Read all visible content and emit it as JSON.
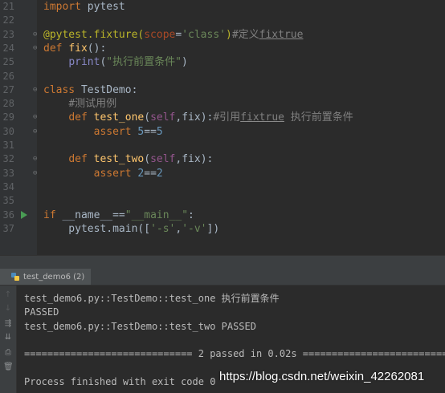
{
  "editor": {
    "line_numbers": [
      "21",
      "22",
      "23",
      "24",
      "25",
      "26",
      "27",
      "28",
      "29",
      "30",
      "31",
      "32",
      "33",
      "34",
      "35",
      "36",
      "37"
    ],
    "lines": [
      [
        {
          "t": "import",
          "c": "kw"
        },
        {
          "t": " pytest",
          "c": ""
        }
      ],
      [],
      [
        {
          "t": "@pytest.fixture(",
          "c": "dec"
        },
        {
          "t": "scope",
          "c": "param"
        },
        {
          "t": "=",
          "c": ""
        },
        {
          "t": "'class'",
          "c": "str"
        },
        {
          "t": ")",
          "c": "dec"
        },
        {
          "t": "#定义",
          "c": "cmt"
        },
        {
          "t": "fixtrue",
          "c": "cmt link"
        }
      ],
      [
        {
          "t": "def ",
          "c": "kw"
        },
        {
          "t": "fix",
          "c": "fn"
        },
        {
          "t": "():",
          "c": ""
        }
      ],
      [
        {
          "t": "    ",
          "c": ""
        },
        {
          "t": "print",
          "c": "bi"
        },
        {
          "t": "(",
          "c": ""
        },
        {
          "t": "\"执行前置条件\"",
          "c": "str"
        },
        {
          "t": ")",
          "c": ""
        }
      ],
      [],
      [
        {
          "t": "class ",
          "c": "kw"
        },
        {
          "t": "TestDemo:",
          "c": ""
        }
      ],
      [
        {
          "t": "    ",
          "c": ""
        },
        {
          "t": "#测试用例",
          "c": "cmt"
        }
      ],
      [
        {
          "t": "    ",
          "c": ""
        },
        {
          "t": "def ",
          "c": "kw"
        },
        {
          "t": "test_one",
          "c": "fn"
        },
        {
          "t": "(",
          "c": ""
        },
        {
          "t": "self",
          "c": "self"
        },
        {
          "t": ",fix):",
          "c": ""
        },
        {
          "t": "#引用",
          "c": "cmt"
        },
        {
          "t": "fixtrue",
          "c": "cmt link"
        },
        {
          "t": " 执行前置条件",
          "c": "cmt"
        }
      ],
      [
        {
          "t": "        ",
          "c": ""
        },
        {
          "t": "assert ",
          "c": "kw"
        },
        {
          "t": "5",
          "c": "num"
        },
        {
          "t": "==",
          "c": ""
        },
        {
          "t": "5",
          "c": "num"
        }
      ],
      [],
      [
        {
          "t": "    ",
          "c": ""
        },
        {
          "t": "def ",
          "c": "kw"
        },
        {
          "t": "test_two",
          "c": "fn"
        },
        {
          "t": "(",
          "c": ""
        },
        {
          "t": "self",
          "c": "self"
        },
        {
          "t": ",fix):",
          "c": ""
        }
      ],
      [
        {
          "t": "        ",
          "c": ""
        },
        {
          "t": "assert ",
          "c": "kw"
        },
        {
          "t": "2",
          "c": "num"
        },
        {
          "t": "==",
          "c": ""
        },
        {
          "t": "2",
          "c": "num"
        }
      ],
      [],
      [],
      [
        {
          "t": "if ",
          "c": "kw"
        },
        {
          "t": "__name__",
          "c": ""
        },
        {
          "t": "==",
          "c": ""
        },
        {
          "t": "\"__main__\"",
          "c": "str"
        },
        {
          "t": ":",
          "c": ""
        }
      ],
      [
        {
          "t": "    pytest.main([",
          "c": ""
        },
        {
          "t": "'-s'",
          "c": "str"
        },
        {
          "t": ",",
          "c": ""
        },
        {
          "t": "'-v'",
          "c": "str"
        },
        {
          "t": "])",
          "c": ""
        }
      ]
    ],
    "fold_lines": [
      23,
      24,
      27,
      29,
      30,
      32,
      33
    ],
    "run_line": 36
  },
  "run_tab": {
    "label": "test_demo6 (2)"
  },
  "toolbar": {
    "buttons": [
      {
        "name": "arrow-up-icon",
        "glyph": "↑",
        "dim": true
      },
      {
        "name": "arrow-down-icon",
        "glyph": "↓",
        "dim": true
      },
      {
        "name": "soft-wrap-icon",
        "glyph": "⇶",
        "dim": false
      },
      {
        "name": "scroll-to-end-icon",
        "glyph": "⇊",
        "dim": false
      },
      {
        "name": "print-icon",
        "glyph": "⎙",
        "dim": false
      },
      {
        "name": "trash-icon",
        "glyph": "🗑",
        "dim": false
      }
    ]
  },
  "console": {
    "lines": [
      "test_demo6.py::TestDemo::test_one 执行前置条件",
      "PASSED",
      "test_demo6.py::TestDemo::test_two PASSED",
      "",
      "============================= 2 passed in 0.02s =============================",
      "",
      "Process finished with exit code 0"
    ]
  },
  "watermark": "https://blog.csdn.net/weixin_42262081",
  "colors": {
    "background": "#2b2b2b",
    "keyword": "#cc7832",
    "function": "#ffc66d",
    "string": "#6a8759",
    "number": "#6897bb",
    "comment": "#808080",
    "run_marker": "#499c54"
  }
}
